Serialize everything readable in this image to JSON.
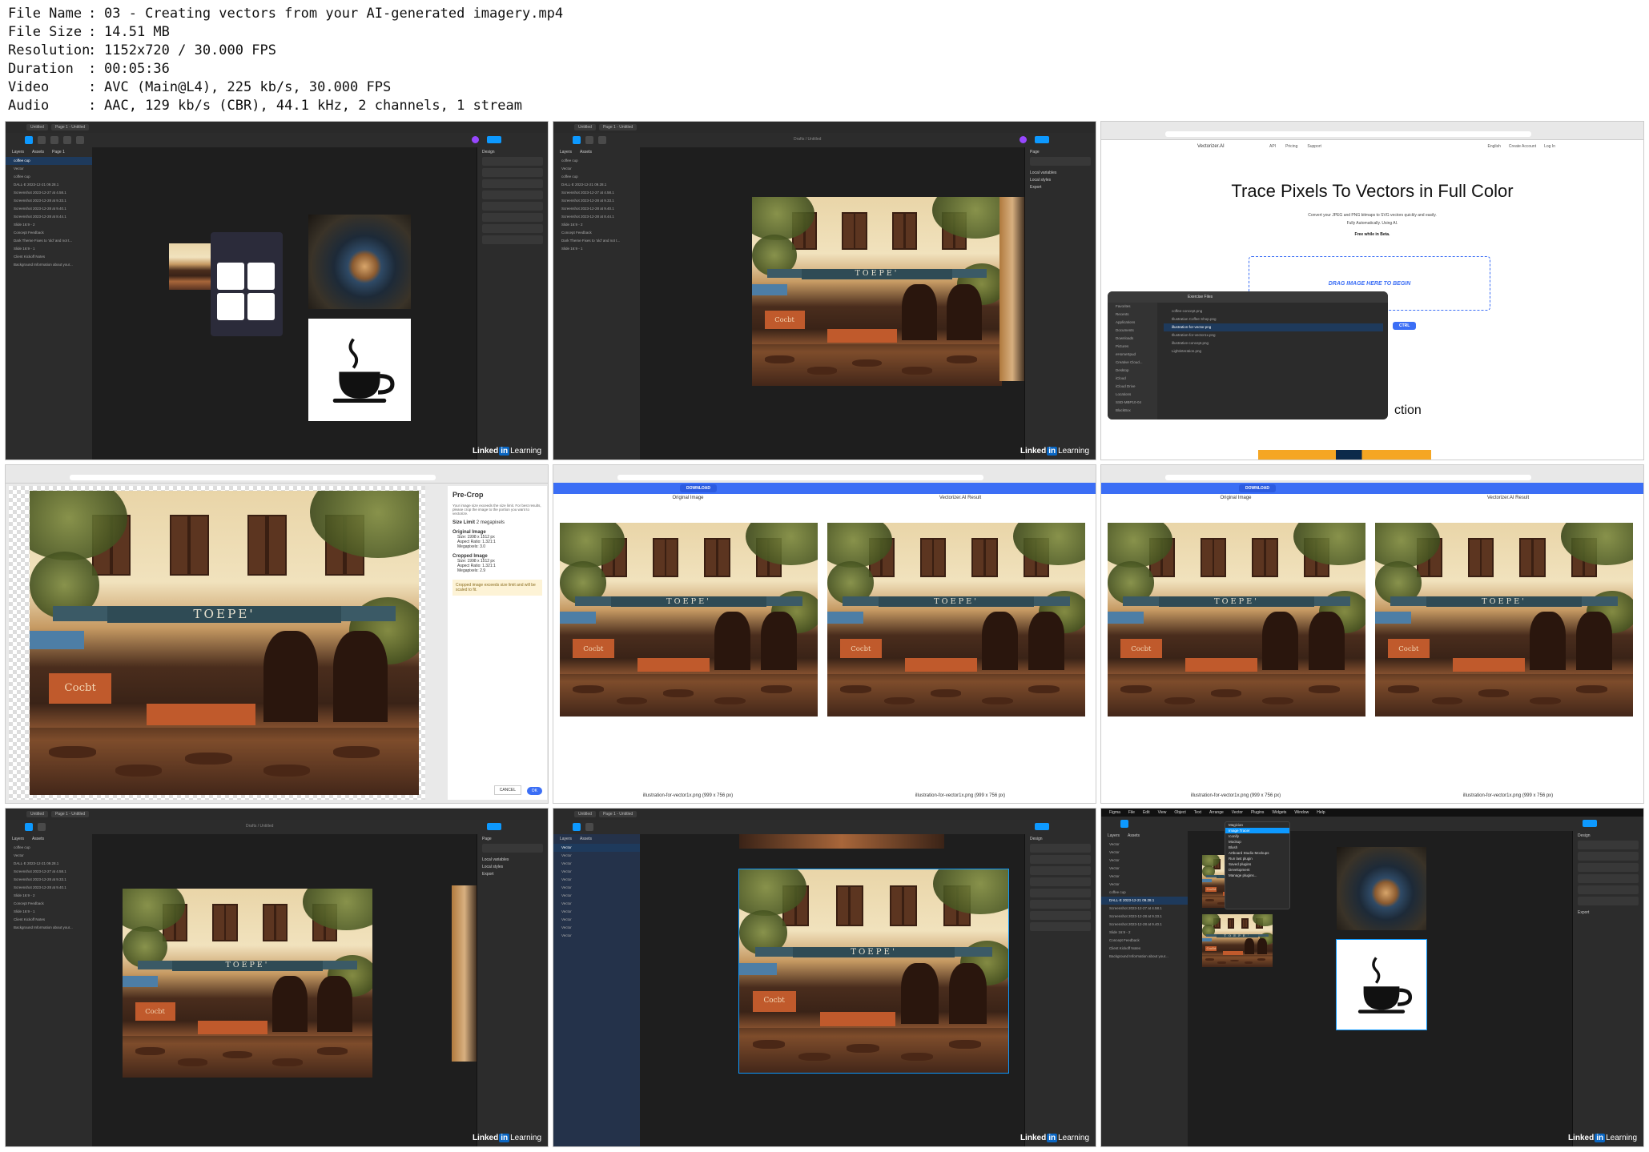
{
  "info": [
    {
      "key": "File Name",
      "sep": ":",
      "val": "03 - Creating vectors from your AI-generated imagery.mp4"
    },
    {
      "key": "File Size",
      "sep": ":",
      "val": "14.51 MB"
    },
    {
      "key": "Resolution",
      "sep": ":",
      "val": "1152x720 / 30.000 FPS"
    },
    {
      "key": "Duration",
      "sep": ":",
      "val": "00:05:36"
    },
    {
      "key": "Video",
      "sep": ":",
      "val": "AVC (Main@L4), 225 kb/s, 30.000 FPS"
    },
    {
      "key": "Audio",
      "sep": ":",
      "val": "AAC, 129 kb/s (CBR), 44.1 kHz, 2 channels, 1 stream"
    }
  ],
  "watermark": {
    "brand": "Linked",
    "in": "in",
    "suffix": "Learning"
  },
  "figma": {
    "page_tab": "Page 1 - Untitled",
    "tab_file": "Untitled",
    "panel_layers": "Layers",
    "panel_assets": "Assets",
    "panel_page": "Page 1",
    "design_tab": "Design",
    "prototype_tab": "Prototype",
    "drafts_title": "Drafts / Untitled",
    "layers": [
      "coffee cup",
      "Vector",
      "coffee cup",
      "DALL·E 2023-12-21 09.28.1",
      "Screenshot 2023-12-27 at 4.58.1",
      "Screenshot 2023-12-28 at 9.33.1",
      "Screenshot 2023-12-28 at 9.40.1",
      "Screenshot 2023-12-28 at 8.44.1",
      "Slide 16:9 - 2",
      "Concept Feedback",
      "Dark Theme Fixes to 'old' and not t...",
      "Slide 16:9 - 1",
      "Client Kickoff Notes",
      "Background Information about your..."
    ],
    "right_labels": [
      "Page",
      "Local variables",
      "Local styles",
      "Export"
    ],
    "plugin_menu": [
      "Magician",
      "Image Tracer",
      "Iconify",
      "Mockup",
      "Blush",
      "Artboard Studio Mockups",
      "Run last plugin",
      "Saved plugins",
      "Development",
      "Manage plugins..."
    ],
    "menubar": [
      "Figma",
      "File",
      "Edit",
      "View",
      "Object",
      "Text",
      "Arrange",
      "Vector",
      "Plugins",
      "Widgets",
      "Window",
      "Help"
    ]
  },
  "vectorizer": {
    "brand": "Vectorizer.AI",
    "nav": [
      "API",
      "Pricing",
      "Support"
    ],
    "lang": "English",
    "create": "Create Account",
    "login": "Log In",
    "headline": "Trace Pixels To Vectors in Full Color",
    "sub1": "Convert your JPEG and PNG bitmaps to SVG vectors quickly and easily.",
    "sub2": "Fully Automatically. Using AI.",
    "free": "Free while in Beta.",
    "drop": "DRAG IMAGE HERE TO BEGIN",
    "ctrl": "CTRL",
    "section_tail": "ction",
    "finder_title": "Exercise Files",
    "finder_sidebar": [
      "Favorites",
      "Recents",
      "Applications",
      "Documents",
      "Downloads",
      "Pictures",
      "eHomeSpud",
      "Creative Cloud...",
      "Desktop",
      "iCloud",
      "iCloud Drive",
      "Locations",
      "SSD-MBP10-04",
      "BlackBox"
    ],
    "finder_files": [
      "coffee-concept.png",
      "Illustration Coffee Shop.png",
      "illustration-for-vector.png",
      "Illustration-for-vector1x.png",
      "illustrative-concept.png",
      "Lightinteration.png"
    ],
    "precrop_title": "Pre-Crop",
    "precrop_desc": "Your image size exceeds the size limit. For best results, please crop the image to the portion you want to vectorize.",
    "size_limit_label": "Size Limit",
    "size_limit_val": "2 megapixels",
    "orig_title": "Original Image",
    "orig_size": "Size: 1998 x 1512 px",
    "orig_ratio": "Aspect Ratio: 1.321:1",
    "orig_mp": "Megapixels: 3.0",
    "crop_title": "Cropped Image",
    "crop_size": "Size: 1998 x 1512 px",
    "crop_ratio": "Aspect Ratio: 1.321:1",
    "crop_mp": "Megapixels: 2.9",
    "warn": "Cropped image exceeds size limit and will be scaled to fit.",
    "cancel": "CANCEL",
    "ok": "OK",
    "download": "DOWNLOAD",
    "original_label": "Original Image",
    "result_label": "Vectorizer.AI Result",
    "filename": "illustration-for-vector1x.png (999 x 756 px)"
  },
  "cafe_sign": "TOEPE'",
  "cafe_window_text": "Cocbt",
  "colors": {
    "figma_bg": "#1e1e1e",
    "figma_panel": "#2c2c2c",
    "accent": "#0d99ff",
    "linkedin": "#0a66c2",
    "vector_blue": "#3b6ef5"
  },
  "icons": [
    "search-icon",
    "coffee-cup-icon",
    "close-icon",
    "gear-icon",
    "play-icon"
  ]
}
